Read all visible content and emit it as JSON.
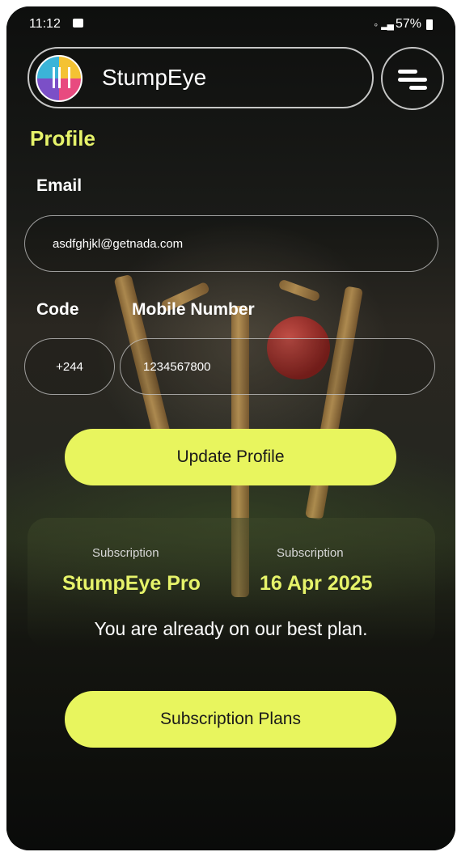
{
  "status_bar": {
    "time": "11:12",
    "battery": "57%"
  },
  "header": {
    "app_title": "StumpEye",
    "logo_icon": "cricket-stumps-logo-icon",
    "menu_icon": "menu-icon"
  },
  "profile": {
    "section_title": "Profile",
    "email_label": "Email",
    "email_value": "asdfghjkl@getnada.com",
    "code_label": "Code",
    "mobile_label": "Mobile Number",
    "code_value": "+244",
    "mobile_value": "1234567800",
    "update_button": "Update Profile"
  },
  "subscription": {
    "plan_caption": "Subscription",
    "plan_value": "StumpEye Pro",
    "date_caption": "Subscription",
    "date_value": "16 Apr 2025",
    "note": "You are already on our best plan.",
    "plans_button": "Subscription Plans"
  },
  "colors": {
    "accent": "#e8f55e",
    "title_accent": "#e6f36a",
    "background": "#0b0c0b"
  }
}
